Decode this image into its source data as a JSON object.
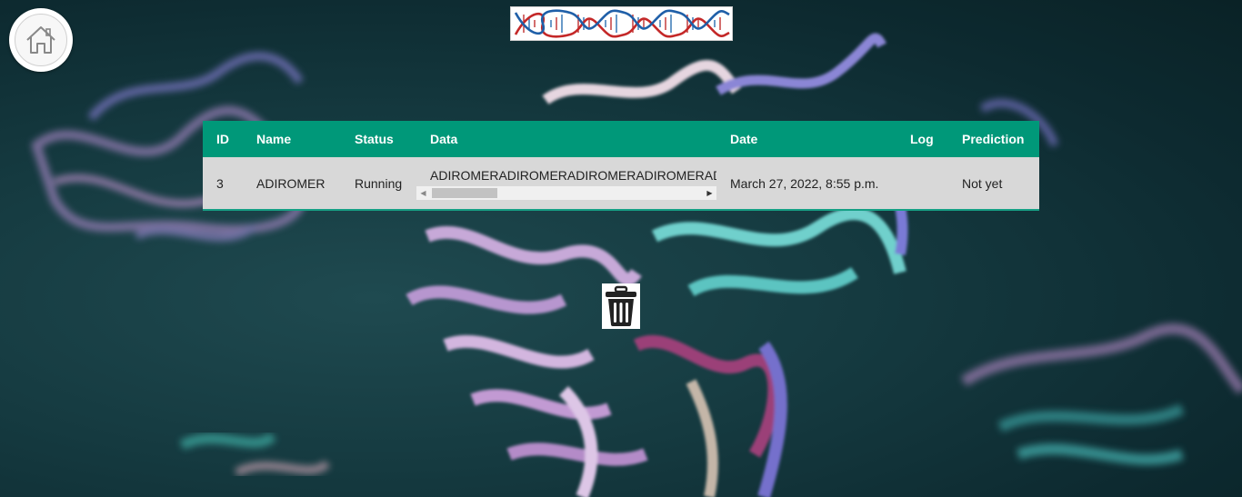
{
  "header": {
    "home_icon": "home-icon",
    "logo_icon": "dna-helix-logo"
  },
  "table": {
    "columns": [
      "ID",
      "Name",
      "Status",
      "Data",
      "Date",
      "Log",
      "Prediction"
    ],
    "rows": [
      {
        "id": "3",
        "name": "ADIROMER",
        "status": "Running",
        "data": "ADIROMERADIROMERADIROMERADIROMERADIROMER",
        "date": "March 27, 2022, 8:55 p.m.",
        "log": "",
        "prediction": "Not yet"
      }
    ],
    "header_color": "#009879",
    "row_color": "#d8d8d8"
  },
  "actions": {
    "delete_icon": "trash-icon"
  }
}
